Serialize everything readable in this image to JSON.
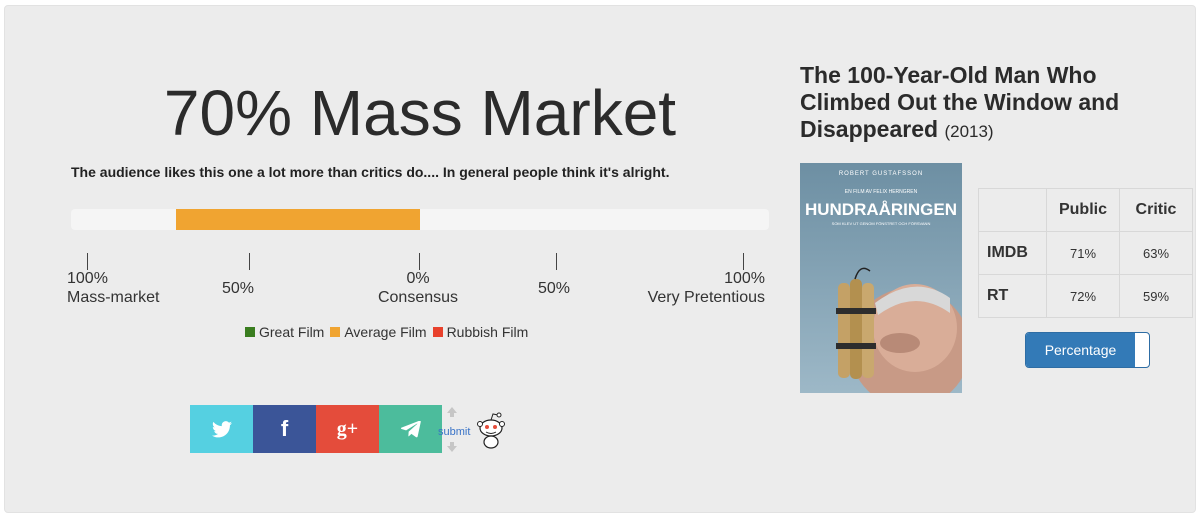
{
  "verdict": {
    "headline": "70% Mass Market",
    "description": "The audience likes this one a lot more than critics do.... In general people think it's alright.",
    "bar": {
      "start_fraction": 0.15,
      "end_fraction": 0.5,
      "color": "#f0a431",
      "track_color": "#f5f5f5"
    }
  },
  "scale": {
    "ticks": [
      {
        "line1": "100%",
        "line2": "Mass-market"
      },
      {
        "line1": "50%",
        "line2": ""
      },
      {
        "line1": "0%",
        "line2": "Consensus"
      },
      {
        "line1": "50%",
        "line2": ""
      },
      {
        "line1": "100%",
        "line2": "Very Pretentious"
      }
    ]
  },
  "legend": [
    {
      "label": "Great Film",
      "color": "#3a7d1f"
    },
    {
      "label": "Average Film",
      "color": "#f0a431"
    },
    {
      "label": "Rubbish Film",
      "color": "#e8412c"
    }
  ],
  "share": {
    "buttons": [
      {
        "name": "twitter",
        "icon": "twitter-icon",
        "color": "#55d0e1"
      },
      {
        "name": "facebook",
        "icon": "facebook-icon",
        "color": "#3b5598",
        "glyph": "f"
      },
      {
        "name": "google-plus",
        "icon": "google-plus-icon",
        "color": "#e44c3b",
        "glyph": "g+"
      },
      {
        "name": "telegram",
        "icon": "telegram-icon",
        "color": "#4cbc9c"
      }
    ],
    "reddit_submit": "submit"
  },
  "movie": {
    "title": "The 100-Year-Old Man Who Climbed Out the Window and Disappeared",
    "year": "(2013)",
    "poster": {
      "top_credit": "ROBERT GUSTAFSSON",
      "subtitle": "EN FILM AV FELIX HERNGREN",
      "title": "HUNDRAÅRINGEN",
      "tagline": "SOM KLEV UT GENOM FÖNSTRET OCH FÖRSVANN"
    }
  },
  "ratings": {
    "columns": [
      "",
      "Public",
      "Critic"
    ],
    "rows": [
      {
        "source": "IMDB",
        "public": "71%",
        "critic": "63%"
      },
      {
        "source": "RT",
        "public": "72%",
        "critic": "59%"
      }
    ]
  },
  "toggle": {
    "label": "Percentage",
    "state": "on"
  }
}
